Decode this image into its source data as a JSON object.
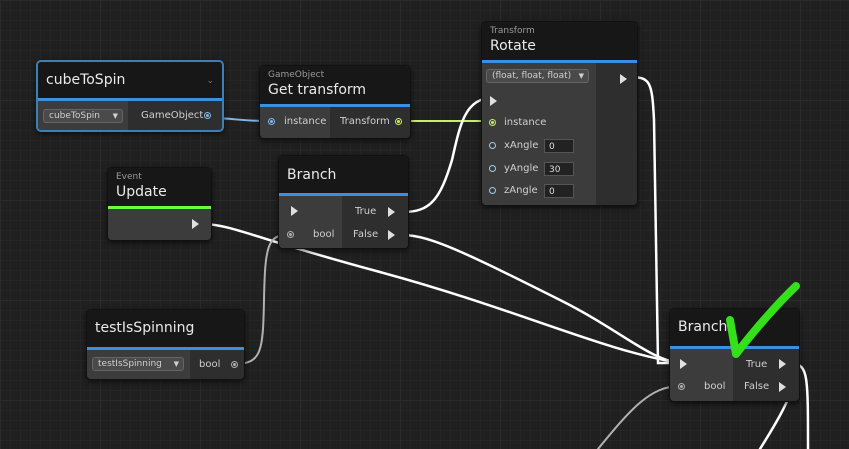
{
  "canvas": {
    "background": "#202020"
  },
  "colors": {
    "exec_wire": "#ffffff",
    "gameobject_port": "#7fb8e8",
    "transform_port": "#c6f06a",
    "bool_port": "#b0b0b0",
    "header_accent": "#3a8fe0",
    "event_accent": "#6bff3b",
    "checkmark": "#33e01a"
  },
  "nodes": {
    "cube_to_spin": {
      "title": "cubeToSpin",
      "dropdown_value": "cubeToSpin",
      "output_label": "GameObject",
      "icon": "chevron-down-icon"
    },
    "get_transform": {
      "subtitle": "GameObject",
      "title": "Get transform",
      "input_label": "instance",
      "output_label": "Transform"
    },
    "rotate": {
      "subtitle": "Transform",
      "title": "Rotate",
      "overload": "(float, float, float)",
      "instance_label": "instance",
      "x_label": "xAngle",
      "x_value": "0",
      "y_label": "yAngle",
      "y_value": "30",
      "z_label": "zAngle",
      "z_value": "0"
    },
    "update": {
      "subtitle": "Event",
      "title": "Update"
    },
    "branch_1": {
      "title": "Branch",
      "cond_label": "bool",
      "true_label": "True",
      "false_label": "False"
    },
    "test_is_spinning": {
      "title": "testIsSpinning",
      "dropdown_value": "testIsSpinning",
      "output_label": "bool"
    },
    "branch_2": {
      "title": "Branch",
      "cond_label": "bool",
      "true_label": "True",
      "false_label": "False"
    }
  }
}
